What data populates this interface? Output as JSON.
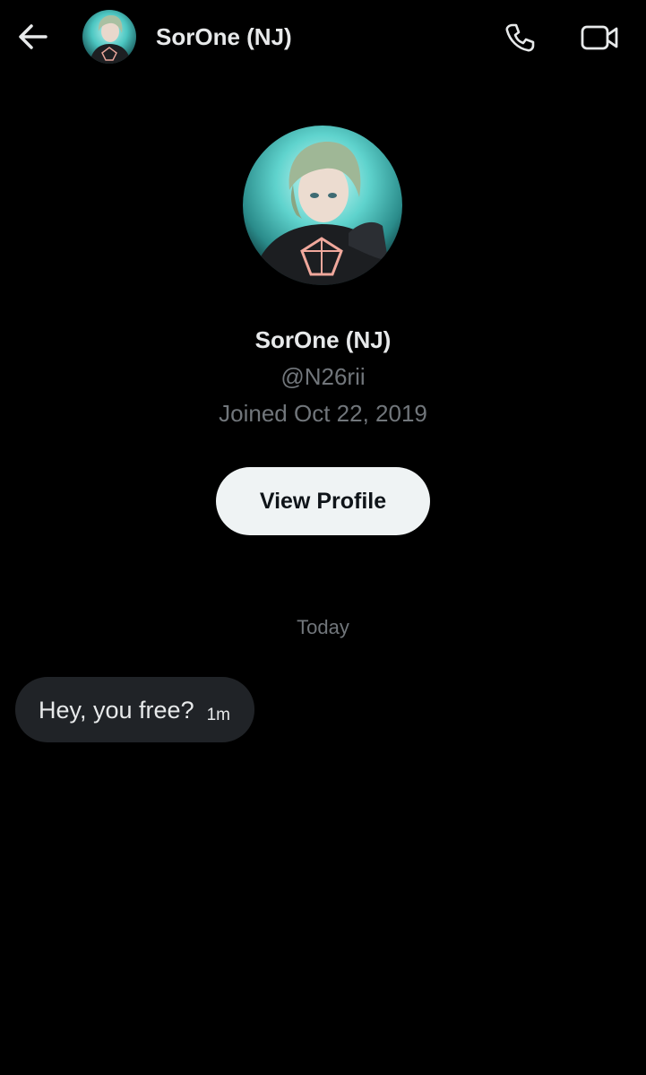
{
  "header": {
    "contact_name": "SorOne (NJ)",
    "icons": {
      "back": "arrow-left-icon",
      "call": "phone-icon",
      "video": "video-camera-icon"
    }
  },
  "profile": {
    "display_name": "SorOne (NJ)",
    "handle": "@N26rii",
    "joined": "Joined Oct 22, 2019",
    "view_profile_label": "View Profile"
  },
  "conversation": {
    "date_divider": "Today",
    "messages": [
      {
        "text": "Hey, you free?",
        "time": "1m"
      }
    ]
  },
  "colors": {
    "background": "#000000",
    "primary_text": "#e7e9ea",
    "secondary_text": "#71767b",
    "button_bg": "#eff3f4",
    "bubble_bg": "#202327"
  }
}
